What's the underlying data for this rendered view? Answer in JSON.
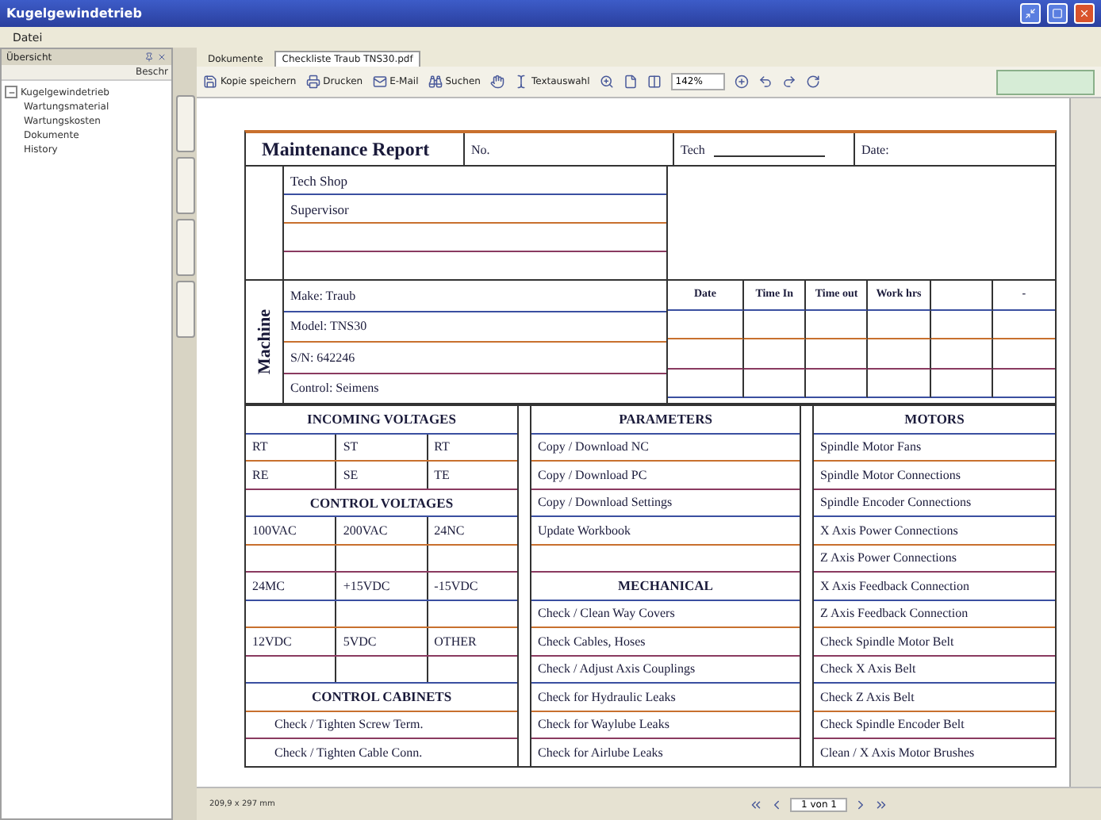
{
  "window": {
    "title": "Kugelgewindetrieb"
  },
  "menu": [
    "Datei"
  ],
  "sidebar": {
    "title": "Übersicht",
    "action": "Beschr",
    "tree": [
      {
        "label": "Kugelgewindetrieb",
        "expanded": true,
        "children": [
          {
            "label": "Wartungsmaterial"
          },
          {
            "label": "Wartungskosten"
          },
          {
            "label": "Dokumente"
          },
          {
            "label": "History"
          }
        ]
      }
    ]
  },
  "doc_tabs": [
    {
      "label": "Dokumente",
      "selected": false
    },
    {
      "label": "Checkliste Traub TNS30.pdf",
      "selected": true
    }
  ],
  "toolbar": {
    "buttons": [
      "Kopie speichern",
      "Drucken",
      "E-Mail",
      "Suchen",
      "Textauswahl"
    ],
    "zoom": "142%"
  },
  "form": {
    "title": "Maintenance Report",
    "no": "No.",
    "tech": "Tech",
    "date": "Date:",
    "shop_lines": [
      "Tech Shop",
      "Supervisor"
    ],
    "machine_label": "Machine",
    "machine_lines": [
      "Make: Traub",
      "Model: TNS30",
      "S/N: 642246",
      "Control: Seimens"
    ],
    "log_columns": [
      "Date",
      "Time In",
      "Time out",
      "Work hrs",
      "",
      "-"
    ],
    "left_rows": [
      {
        "kind": "heading",
        "text": "INCOMING VOLTAGES"
      },
      {
        "kind": "cells",
        "cells": [
          "RT",
          "ST",
          "RT"
        ]
      },
      {
        "kind": "cells",
        "cells": [
          "RE",
          "SE",
          "TE"
        ]
      },
      {
        "kind": "heading",
        "text": "CONTROL VOLTAGES"
      },
      {
        "kind": "cells",
        "cells": [
          "100VAC",
          "200VAC",
          "24NC"
        ]
      },
      {
        "kind": "blank"
      },
      {
        "kind": "cells",
        "cells": [
          "24MC",
          "+15VDC",
          "-15VDC"
        ]
      },
      {
        "kind": "blank"
      },
      {
        "kind": "cells",
        "cells": [
          "12VDC",
          "5VDC",
          "OTHER"
        ]
      },
      {
        "kind": "blank"
      },
      {
        "kind": "heading",
        "text": "CONTROL CABINETS"
      },
      {
        "kind": "item",
        "text": "Check / Tighten Screw Term."
      },
      {
        "kind": "item",
        "text": "Check / Tighten Cable Conn."
      }
    ],
    "middle_rows": [
      {
        "kind": "heading",
        "text": "PARAMETERS"
      },
      {
        "kind": "item",
        "text": "Copy / Download NC"
      },
      {
        "kind": "item",
        "text": "Copy / Download PC"
      },
      {
        "kind": "item",
        "text": "Copy / Download Settings"
      },
      {
        "kind": "item",
        "text": "Update Workbook"
      },
      {
        "kind": "blank"
      },
      {
        "kind": "heading",
        "text": "MECHANICAL"
      },
      {
        "kind": "item",
        "text": "Check / Clean Way Covers"
      },
      {
        "kind": "item",
        "text": "Check Cables, Hoses"
      },
      {
        "kind": "item",
        "text": "Check / Adjust Axis Couplings"
      },
      {
        "kind": "item",
        "text": "Check for Hydraulic Leaks"
      },
      {
        "kind": "item",
        "text": "Check for Waylube Leaks"
      },
      {
        "kind": "item",
        "text": "Check for Airlube Leaks"
      }
    ],
    "right_rows": [
      {
        "kind": "heading",
        "text": "MOTORS"
      },
      {
        "kind": "item",
        "text": "Spindle Motor Fans"
      },
      {
        "kind": "item",
        "text": "Spindle Motor Connections"
      },
      {
        "kind": "item",
        "text": "Spindle Encoder Connections"
      },
      {
        "kind": "item",
        "text": "X Axis Power Connections"
      },
      {
        "kind": "item",
        "text": "Z Axis Power Connections"
      },
      {
        "kind": "item",
        "text": "X Axis Feedback Connection"
      },
      {
        "kind": "item",
        "text": "Z Axis Feedback Connection"
      },
      {
        "kind": "item",
        "text": "Check Spindle Motor Belt"
      },
      {
        "kind": "item",
        "text": "Check X Axis Belt"
      },
      {
        "kind": "item",
        "text": "Check Z Axis Belt"
      },
      {
        "kind": "item",
        "text": "Check Spindle Encoder Belt"
      },
      {
        "kind": "item",
        "text": "Clean / X Axis Motor Brushes"
      }
    ]
  },
  "status": {
    "page_size": "209,9 x 297 mm",
    "page": "1 von 1"
  }
}
